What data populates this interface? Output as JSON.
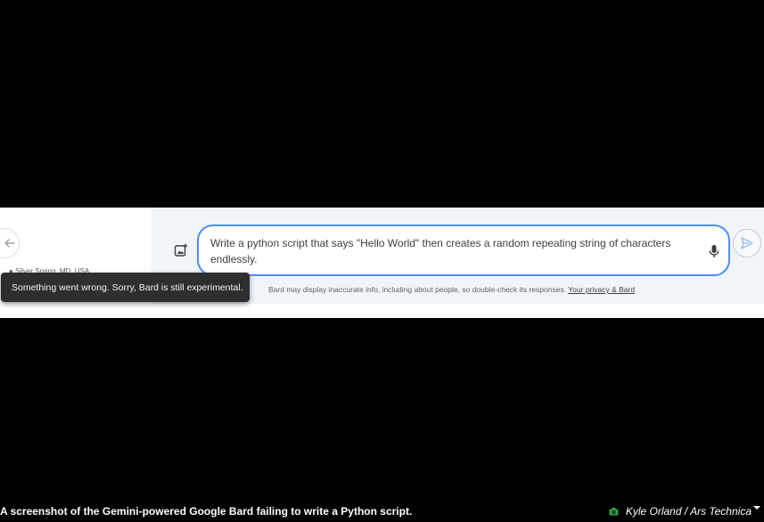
{
  "bard": {
    "location_text": "Silver Spring, MD, USA",
    "prompt_text": "Write a python script that says \"Hello World\" then creates a random repeating string of characters endlessly.",
    "disclaimer_text": "Bard may display inaccurate info, including about people, so double-check its responses.",
    "privacy_link": "Your privacy & Bard",
    "toast_message": "Something went wrong. Sorry, Bard is still experimental."
  },
  "caption": {
    "text": "A screenshot of the Gemini-powered Google Bard failing to write a Python script.",
    "credit": "Kyle Orland / Ars Technica"
  },
  "icons": {
    "back": "arrow-left-icon",
    "image_upload": "add-image-icon",
    "mic": "microphone-icon",
    "send": "send-icon",
    "camera": "camera-icon",
    "caret": "caret-down-icon"
  },
  "colors": {
    "prompt_border": "#4c8df6",
    "pane_bg": "#f1f4f9",
    "toast_bg": "#2d2e30",
    "camera_accent": "#2ea043"
  }
}
